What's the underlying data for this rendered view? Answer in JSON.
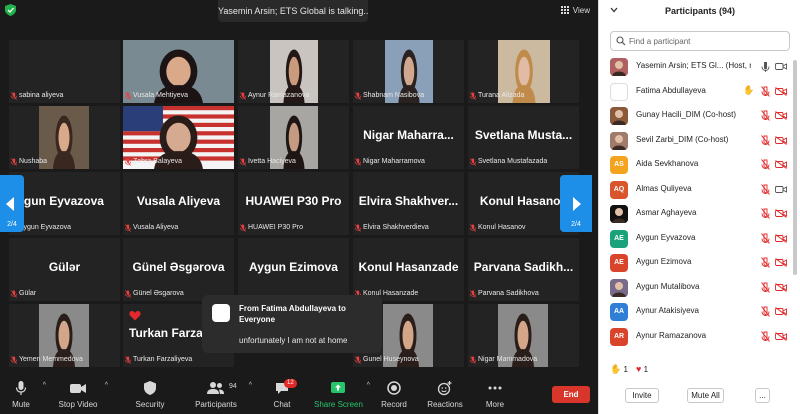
{
  "topbar": {
    "talking": "Yasemin Arsin; ETS Global is talking...",
    "view_label": "View"
  },
  "grid": {
    "tiles": [
      {
        "name": "sabina aliyeva",
        "kind": "blank"
      },
      {
        "name": "Vusala Mehtiyeva",
        "kind": "photo"
      },
      {
        "name": "Aynur Ramazanova",
        "kind": "photo"
      },
      {
        "name": "Shabnam Nasibova",
        "kind": "photo"
      },
      {
        "name": "Turana Alizada",
        "kind": "photo"
      },
      {
        "name": "Nushaba",
        "kind": "photo"
      },
      {
        "name": "Zohra Balayeva",
        "kind": "photo"
      },
      {
        "name": "Ivetta Haciyeva",
        "kind": "photo"
      },
      {
        "name": "Nigar Maharramova",
        "display": "Nigar Maharra...",
        "kind": "text"
      },
      {
        "name": "Svetlana Mustafazada",
        "display": "Svetlana Musta...",
        "kind": "text"
      },
      {
        "name": "Aygun Eyvazova",
        "display": "Aygun Eyvazova",
        "kind": "text"
      },
      {
        "name": "Vusala Aliyeva",
        "display": "Vusala Aliyeva",
        "kind": "text"
      },
      {
        "name": "HUAWEI P30 Pro",
        "display": "HUAWEI P30 Pro",
        "kind": "text"
      },
      {
        "name": "Elvira Shakhverdieva",
        "display": "Elvira Shakhver...",
        "kind": "text"
      },
      {
        "name": "Konul Hasanov",
        "display": "Konul Hasanov",
        "kind": "text"
      },
      {
        "name": "Gülar",
        "display": "Gülər",
        "kind": "text"
      },
      {
        "name": "Günel Əsgarova",
        "display": "Günel Əsgərova",
        "kind": "text"
      },
      {
        "name": "",
        "display": "Aygun Ezimova",
        "kind": "text"
      },
      {
        "name": "Konul Hasanzade",
        "display": "Konul Hasanzade",
        "kind": "text"
      },
      {
        "name": "Parvana Sadikhova",
        "display": "Parvana Sadikh...",
        "kind": "text"
      },
      {
        "name": "Yemen Memmedova",
        "kind": "photo"
      },
      {
        "name": "Turkan Farzaliyeva",
        "display": "Turkan Farza",
        "kind": "text"
      },
      {
        "name": "",
        "kind": "hidden"
      },
      {
        "name": "Gunel Huseynova",
        "kind": "photo"
      },
      {
        "name": "Nigar Mammadova",
        "kind": "photo"
      }
    ],
    "page_left": "2/4",
    "page_right": "2/4"
  },
  "toast": {
    "from": "From Fatima Abdullayeva to Everyone",
    "message": "unfortunately I am not at home"
  },
  "toolbar": {
    "mute": "Mute",
    "stop_video": "Stop Video",
    "security": "Security",
    "participants": "Participants",
    "participants_count": "94",
    "chat": "Chat",
    "chat_badge": "12",
    "share_screen": "Share Screen",
    "record": "Record",
    "reactions": "Reactions",
    "more": "More",
    "end": "End"
  },
  "panel": {
    "title": "Participants (94)",
    "search_placeholder": "Find a participant",
    "participants": [
      {
        "name": "Yasemin Arsin; ETS Gl... (Host, me)",
        "avatar": "photo",
        "color": "#b06060",
        "mic": "on",
        "cam": "on"
      },
      {
        "name": "Fatima Abdullayeva",
        "avatar": "blank",
        "color": "#ffffff",
        "mic": "off",
        "cam": "off",
        "hand": true
      },
      {
        "name": "Gunay Hacili_DIM (Co-host)",
        "avatar": "photo",
        "color": "#8a5a3a",
        "mic": "off",
        "cam": "off"
      },
      {
        "name": "Sevil Zarbi_DIM (Co-host)",
        "avatar": "photo",
        "color": "#a07a6a",
        "mic": "off",
        "cam": "off"
      },
      {
        "name": "Aida Sevkhanova",
        "avatar": "AS",
        "color": "#f3a31e",
        "mic": "off",
        "cam": "off"
      },
      {
        "name": "Almas Quliyeva",
        "avatar": "AQ",
        "color": "#d9552b",
        "mic": "off",
        "cam": "on"
      },
      {
        "name": "Asmar Aghayeva",
        "avatar": "photo",
        "color": "#111111",
        "mic": "off",
        "cam": "off"
      },
      {
        "name": "Aygun Eyvazova",
        "avatar": "AE",
        "color": "#1aa37a",
        "mic": "off",
        "cam": "off"
      },
      {
        "name": "Aygun Ezimova",
        "avatar": "AE",
        "color": "#d9442b",
        "mic": "off",
        "cam": "off"
      },
      {
        "name": "Aygun Mutalibova",
        "avatar": "photo",
        "color": "#7a6a8a",
        "mic": "off",
        "cam": "off"
      },
      {
        "name": "Aynur Atakisiyeva",
        "avatar": "AA",
        "color": "#2f7fd6",
        "mic": "off",
        "cam": "off"
      },
      {
        "name": "Aynur Ramazanova",
        "avatar": "AR",
        "color": "#d9442b",
        "mic": "off",
        "cam": "off"
      }
    ],
    "reaction_hand": "1",
    "reaction_heart": "1",
    "invite": "Invite",
    "mute_all": "Mute All",
    "more": "..."
  }
}
